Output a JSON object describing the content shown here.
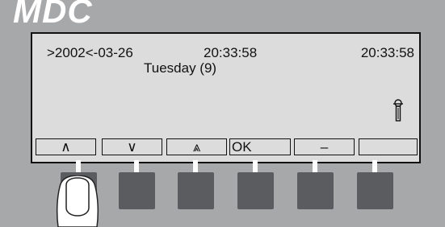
{
  "brand": {
    "logo_text": "MDC"
  },
  "display": {
    "date": ">2002<-03-26",
    "time_left": "20:33:58",
    "time_right": "20:33:58",
    "weekday": "Tuesday (9)",
    "status_icon": "thermometer-icon"
  },
  "softkeys": [
    {
      "label": "∧",
      "icon": "up-caret-icon"
    },
    {
      "label": "∨",
      "icon": "down-caret-icon"
    },
    {
      "label": "⩓",
      "icon": "double-up-caret-icon"
    },
    {
      "label": "OK"
    },
    {
      "label": "–"
    },
    {
      "label": ""
    }
  ],
  "hardware_buttons": 6,
  "colors": {
    "panel": "#a7a8aa",
    "screen": "#dcdcdc",
    "button": "#5b5c5f",
    "logo": "#ffffff"
  }
}
